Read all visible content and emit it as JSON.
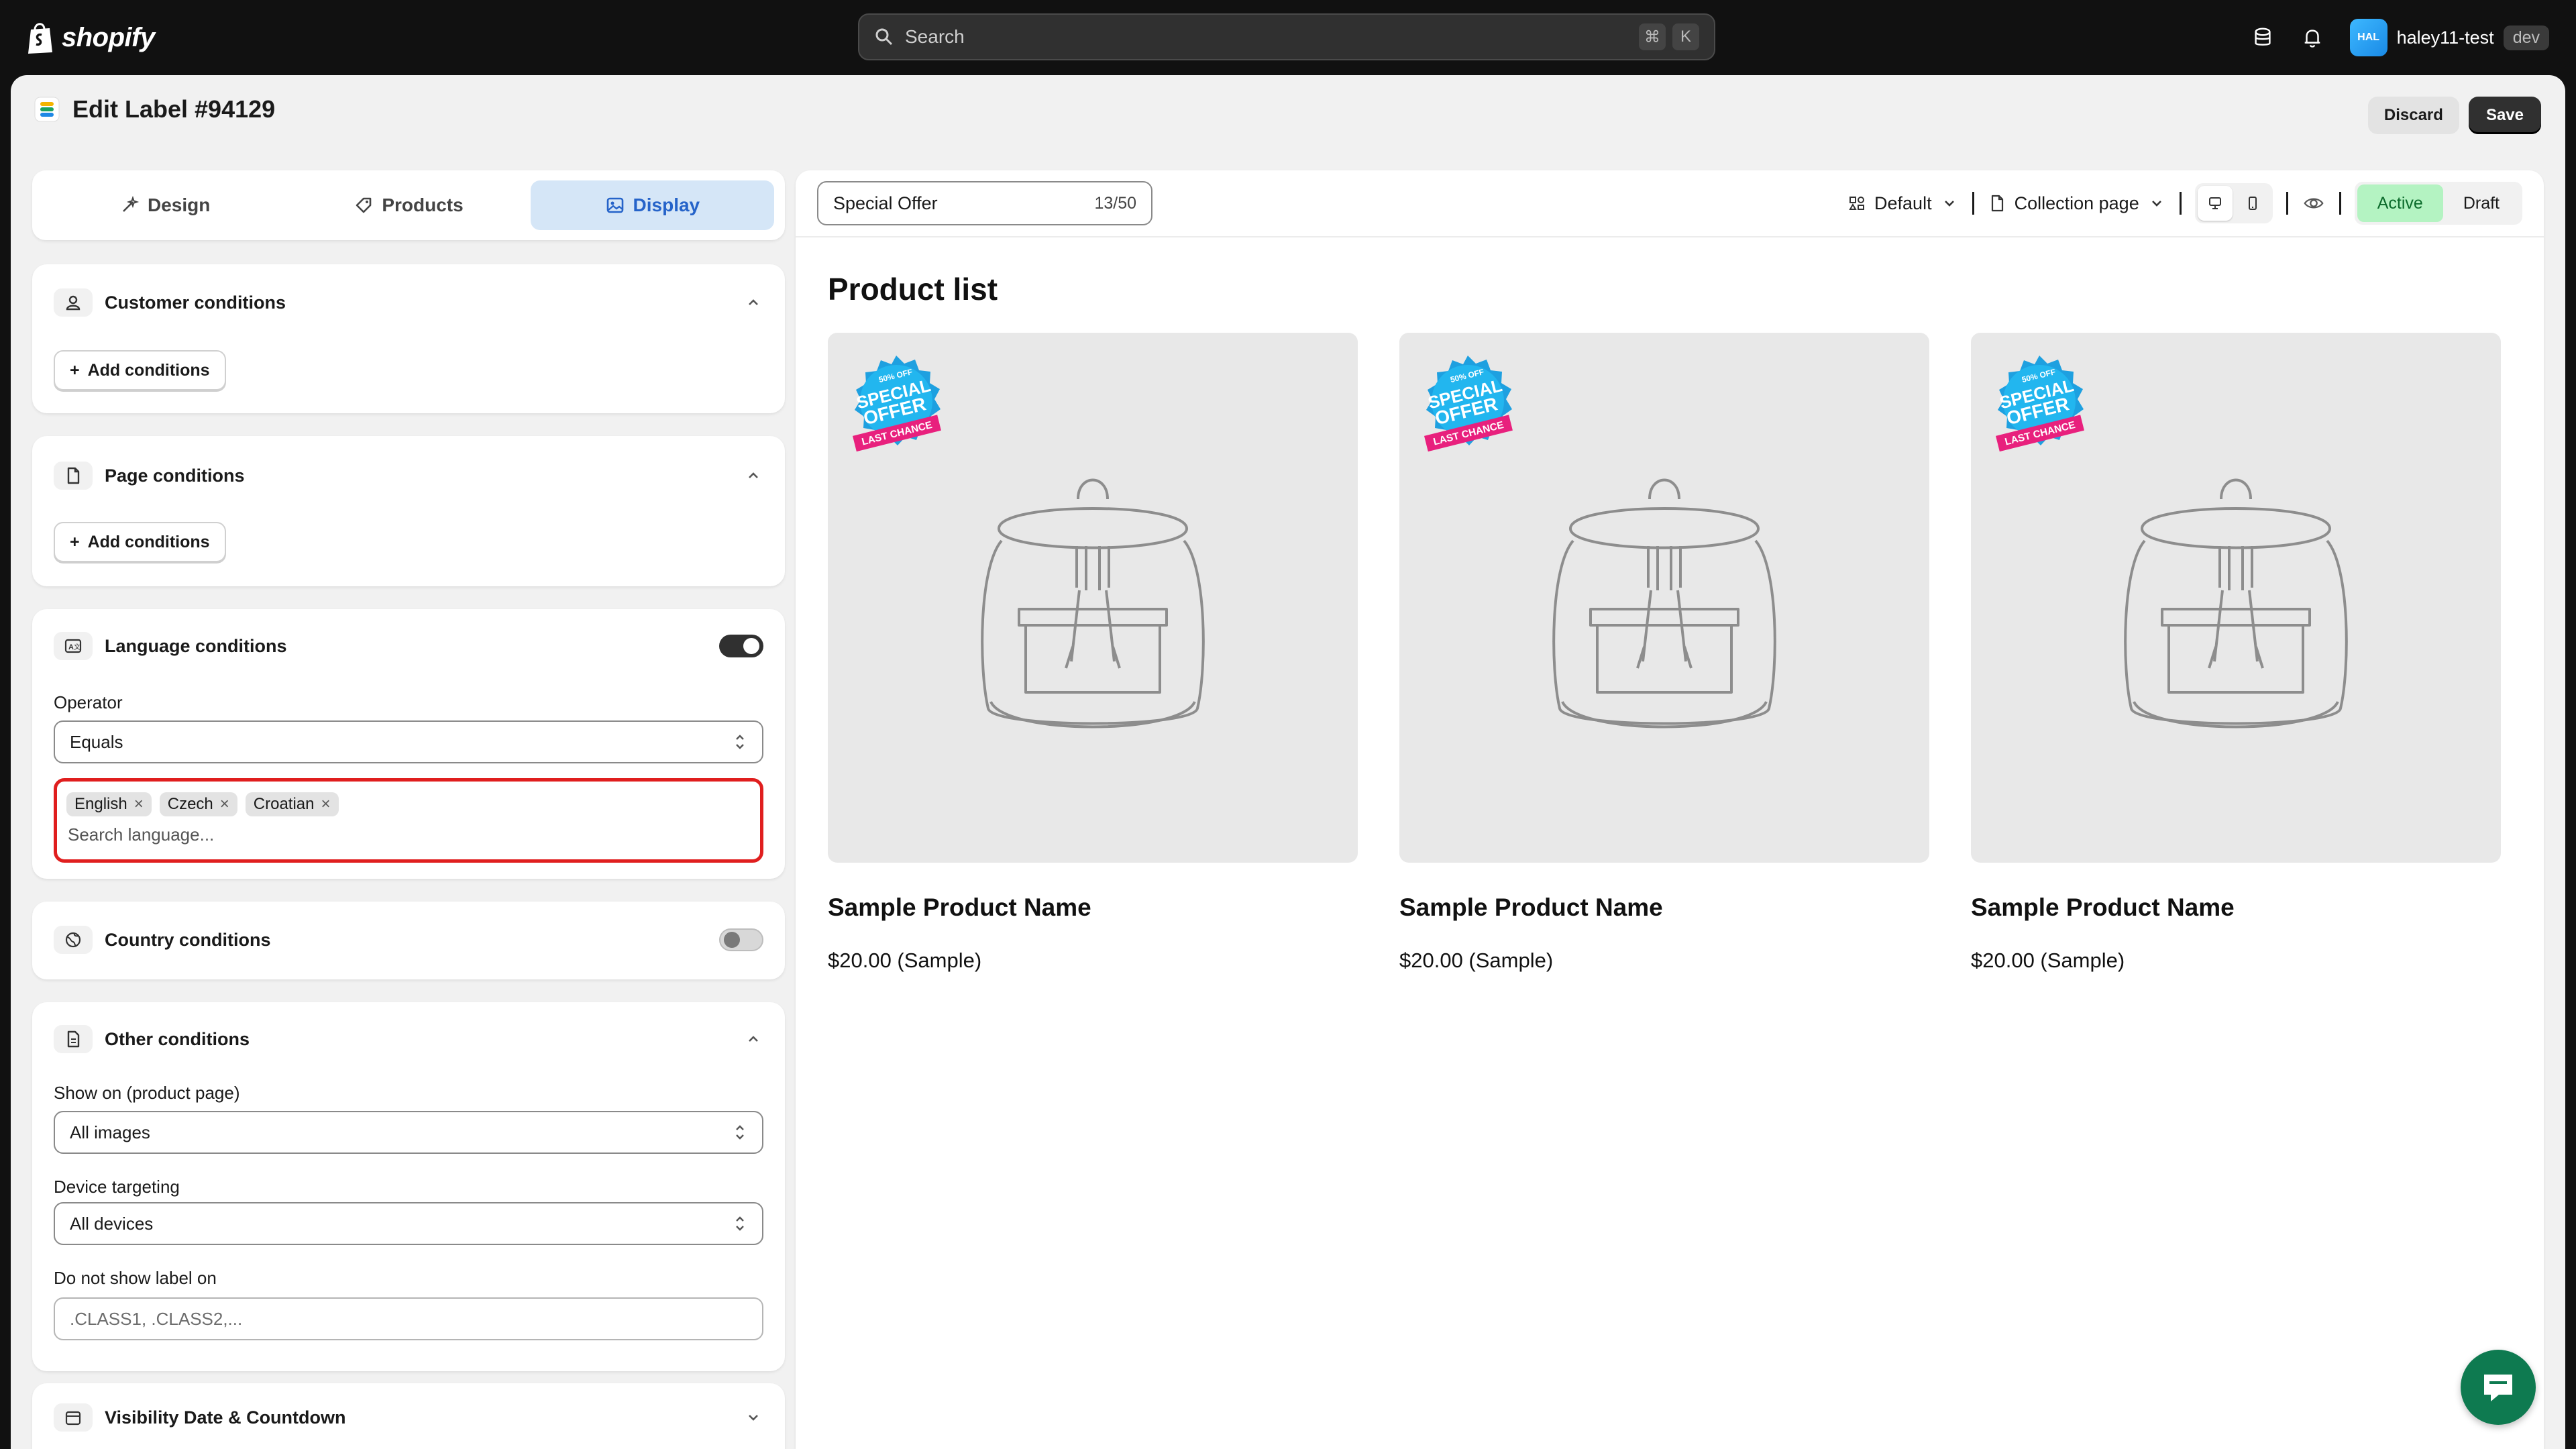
{
  "topbar": {
    "brand": "shopify",
    "search_placeholder": "Search",
    "shortcut_keys": [
      "⌘",
      "K"
    ],
    "user": {
      "initials": "HAL",
      "name": "haley11-test",
      "badge": "dev"
    }
  },
  "header": {
    "title": "Edit Label #94129",
    "discard_label": "Discard",
    "save_label": "Save"
  },
  "tabs": [
    {
      "label": "Design",
      "active": false
    },
    {
      "label": "Products",
      "active": false
    },
    {
      "label": "Display",
      "active": true
    }
  ],
  "conditions": {
    "customer": {
      "title": "Customer conditions",
      "add_label": "Add conditions"
    },
    "page": {
      "title": "Page conditions",
      "add_label": "Add conditions"
    },
    "language": {
      "title": "Language conditions",
      "enabled": true,
      "operator_label": "Operator",
      "operator_value": "Equals",
      "languages": [
        "English",
        "Czech",
        "Croatian"
      ],
      "search_placeholder": "Search language..."
    },
    "country": {
      "title": "Country conditions",
      "enabled": false
    },
    "other": {
      "title": "Other conditions",
      "show_on_label": "Show on (product page)",
      "show_on_value": "All images",
      "device_label": "Device targeting",
      "device_value": "All devices",
      "hide_on_label": "Do not show label on",
      "hide_on_placeholder": ".CLASS1, .CLASS2,..."
    },
    "visibility": {
      "title": "Visibility Date & Countdown"
    }
  },
  "preview": {
    "label_name": "Special Offer",
    "label_count": "13/50",
    "template": "Default",
    "page_type": "Collection page",
    "status_active": "Active",
    "status_draft": "Draft",
    "active_status": "Active",
    "list_title": "Product list",
    "badge_text": {
      "top": "50% OFF",
      "middle1": "SPECIAL",
      "middle2": "OFFER",
      "ribbon": "LAST CHANCE"
    },
    "products": [
      {
        "name": "Sample Product Name",
        "price": "$20.00 (Sample)"
      },
      {
        "name": "Sample Product Name",
        "price": "$20.00 (Sample)"
      },
      {
        "name": "Sample Product Name",
        "price": "$20.00 (Sample)"
      }
    ]
  },
  "colors": {
    "topbar_bg": "#111111",
    "tab_active_bg": "#d5e6f7",
    "tab_active_text": "#2563c9",
    "highlight_border": "#e01e1e",
    "active_status_bg": "#b4f3c2",
    "chat_bg": "#0e7a50"
  },
  "icons": {
    "search": "search-icon",
    "database": "database-icon",
    "bell": "bell-icon",
    "chat": "chat-icon"
  }
}
